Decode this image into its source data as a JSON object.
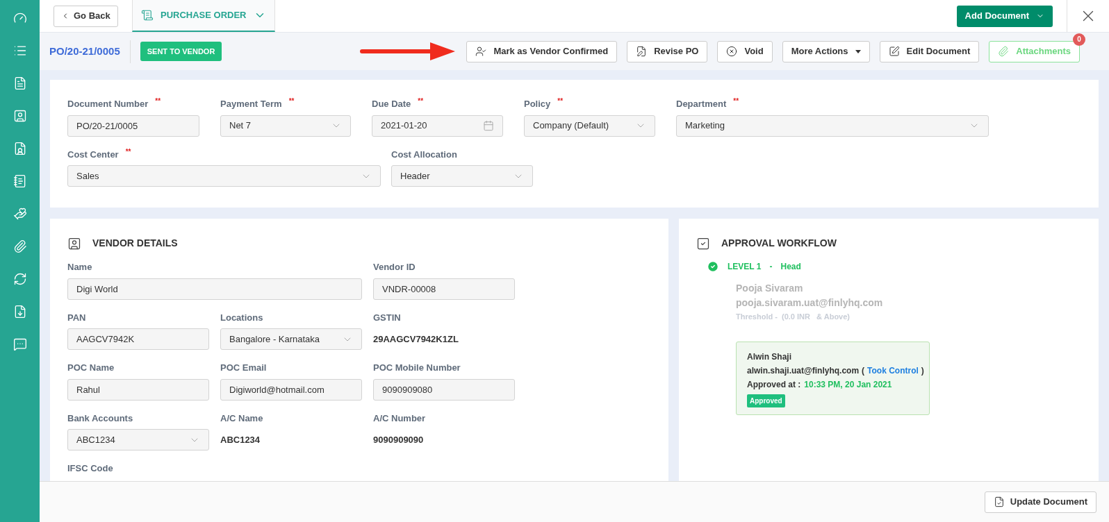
{
  "sidebar": {
    "items": [
      {
        "selected": false
      },
      {
        "selected": false
      },
      {
        "selected": false
      },
      {
        "selected": false
      },
      {
        "selected": false
      },
      {
        "selected": false
      },
      {
        "selected": false
      },
      {
        "selected": false
      },
      {
        "selected": false
      },
      {
        "selected": false
      },
      {
        "selected": false
      }
    ]
  },
  "top_bar": {
    "back": "Go Back",
    "tab": {
      "label": "PURCHASE ORDER",
      "selected": true
    },
    "add_document": "Add Document"
  },
  "action_bar": {
    "doc_number": "PO/20-21/0005",
    "status": "SENT TO VENDOR",
    "actions": [
      {
        "kind": "confirm",
        "label": "Mark as Vendor Confirmed"
      },
      {
        "kind": "revise",
        "label": "Revise PO"
      },
      {
        "kind": "void",
        "label": "Void"
      },
      {
        "kind": "more",
        "label": "More Actions"
      },
      {
        "kind": "edit",
        "label": "Edit Document"
      },
      {
        "kind": "attach",
        "label": "Attachments",
        "badge": "0"
      }
    ]
  },
  "form": {
    "fields": [
      {
        "label": "Document Number",
        "required_mark": "**",
        "kind": "input",
        "value": "PO/20-21/0005"
      },
      {
        "label": "Payment Term",
        "required_mark": "**",
        "kind": "select",
        "value": "Net 7"
      },
      {
        "label": "Due Date",
        "required_mark": "**",
        "kind": "date",
        "value": "2021-01-20"
      },
      {
        "label": "Policy",
        "required_mark": "**",
        "kind": "select",
        "value": "Company (Default)"
      },
      {
        "label": "Department",
        "required_mark": "**",
        "kind": "select",
        "value": "Marketing"
      },
      {
        "label": "Cost Center",
        "required_mark": "**",
        "kind": "select",
        "value": "Sales"
      },
      {
        "label": "Cost Allocation",
        "kind": "select",
        "value": "Header"
      }
    ]
  },
  "vendor": {
    "title": "VENDOR DETAILS",
    "fields": [
      {
        "label": "Name",
        "kind": "input",
        "value": "Digi World"
      },
      {
        "label": "Vendor ID",
        "kind": "input",
        "value": "VNDR-00008"
      },
      {
        "label": "PAN",
        "kind": "input",
        "value": "AAGCV7942K"
      },
      {
        "label": "Locations",
        "kind": "select",
        "value": "Bangalore - Karnataka"
      },
      {
        "label": "GSTIN",
        "kind": "static",
        "value": "29AAGCV7942K1ZL"
      },
      {
        "label": "POC Name",
        "kind": "input",
        "value": "Rahul"
      },
      {
        "label": "POC Email",
        "kind": "input",
        "value": "Digiworld@hotmail.com"
      },
      {
        "label": "POC Mobile Number",
        "kind": "input",
        "value": "9090909080"
      },
      {
        "label": "Bank Accounts",
        "kind": "select",
        "value": "ABC1234"
      },
      {
        "label": "A/C Name",
        "kind": "static",
        "value": "ABC1234"
      },
      {
        "label": "A/C Number",
        "kind": "static",
        "value": "9090909090"
      },
      {
        "label": "IFSC Code",
        "kind": "label"
      }
    ]
  },
  "approval": {
    "title": "APPROVAL WORKFLOW",
    "levels": [
      {
        "level": "LEVEL 1",
        "separator": "-",
        "role": "Head",
        "approved": true,
        "name": "Pooja Sivaram",
        "email": "pooja.sivaram.uat@finlyhq.com",
        "threshold": "Threshold -  (0.0 INR   & Above)",
        "decision": {
          "name": "Alwin Shaji",
          "email": "alwin.shaji.uat@finlyhq.com",
          "paren_open": "(",
          "link": "Took Control",
          "paren_close": ")",
          "approved_label": "Approved at :",
          "time": "10:33 PM, 20 Jan 2021",
          "badge": "Approved"
        }
      }
    ]
  },
  "footer": {
    "update": "Update Document"
  }
}
